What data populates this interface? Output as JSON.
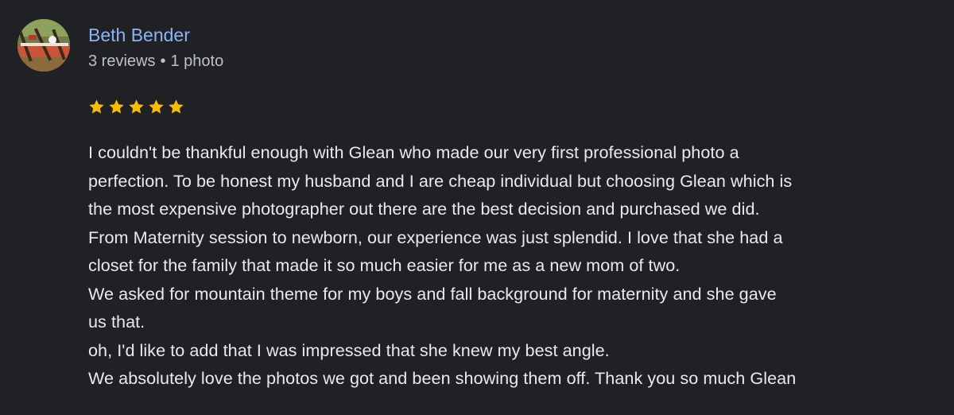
{
  "reviewer": {
    "name": "Beth Bender",
    "review_count": "3 reviews",
    "separator": "•",
    "photo_count": "1 photo"
  },
  "rating": {
    "stars": 5,
    "max": 5,
    "color": "#fbbc04"
  },
  "review": {
    "lines": [
      "I couldn't be thankful enough with Glean who made our very first professional photo a",
      "perfection. To be honest my husband and I are cheap individual but choosing Glean which is",
      "the most expensive photographer out there are the best decision and purchased we did.",
      "From Maternity session to newborn, our experience was just splendid. I love that she had a",
      "closet for the family that made it so much easier for me as a new mom of two.",
      "We asked for mountain theme for my boys and fall background for maternity and she gave",
      "us that.",
      "oh, I'd like to add that I was impressed that she knew my best angle.",
      "We absolutely love the photos we got and been showing them off. Thank you so much Glean"
    ]
  },
  "colors": {
    "background": "#202124",
    "name_link": "#8ab4f8",
    "meta_text": "#bdc1c6",
    "body_text": "#e8eaed"
  }
}
